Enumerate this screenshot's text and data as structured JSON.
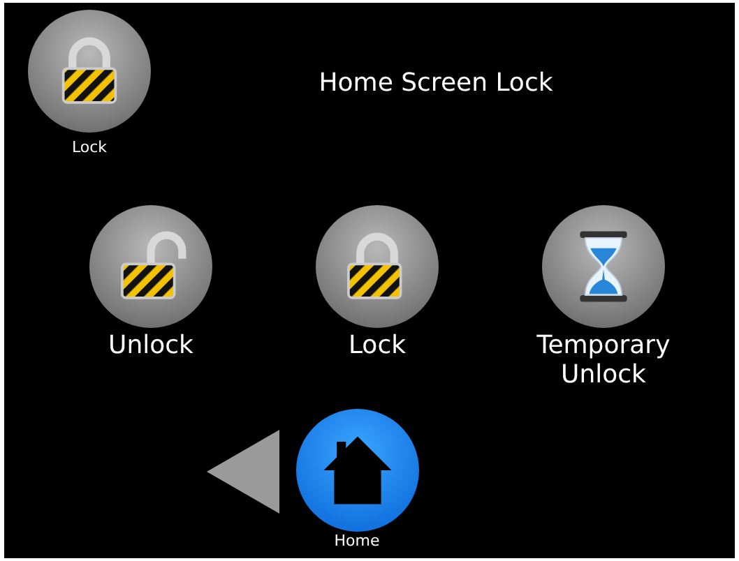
{
  "corner_button": {
    "label": "Lock",
    "kind": "lock"
  },
  "title": "Home Screen Lock",
  "actions": [
    {
      "label": "Unlock",
      "kind": "unlock"
    },
    {
      "label": "Lock",
      "kind": "lock"
    },
    {
      "label": "Temporary Unlock",
      "kind": "timer"
    }
  ],
  "nav": {
    "home_label": "Home"
  }
}
